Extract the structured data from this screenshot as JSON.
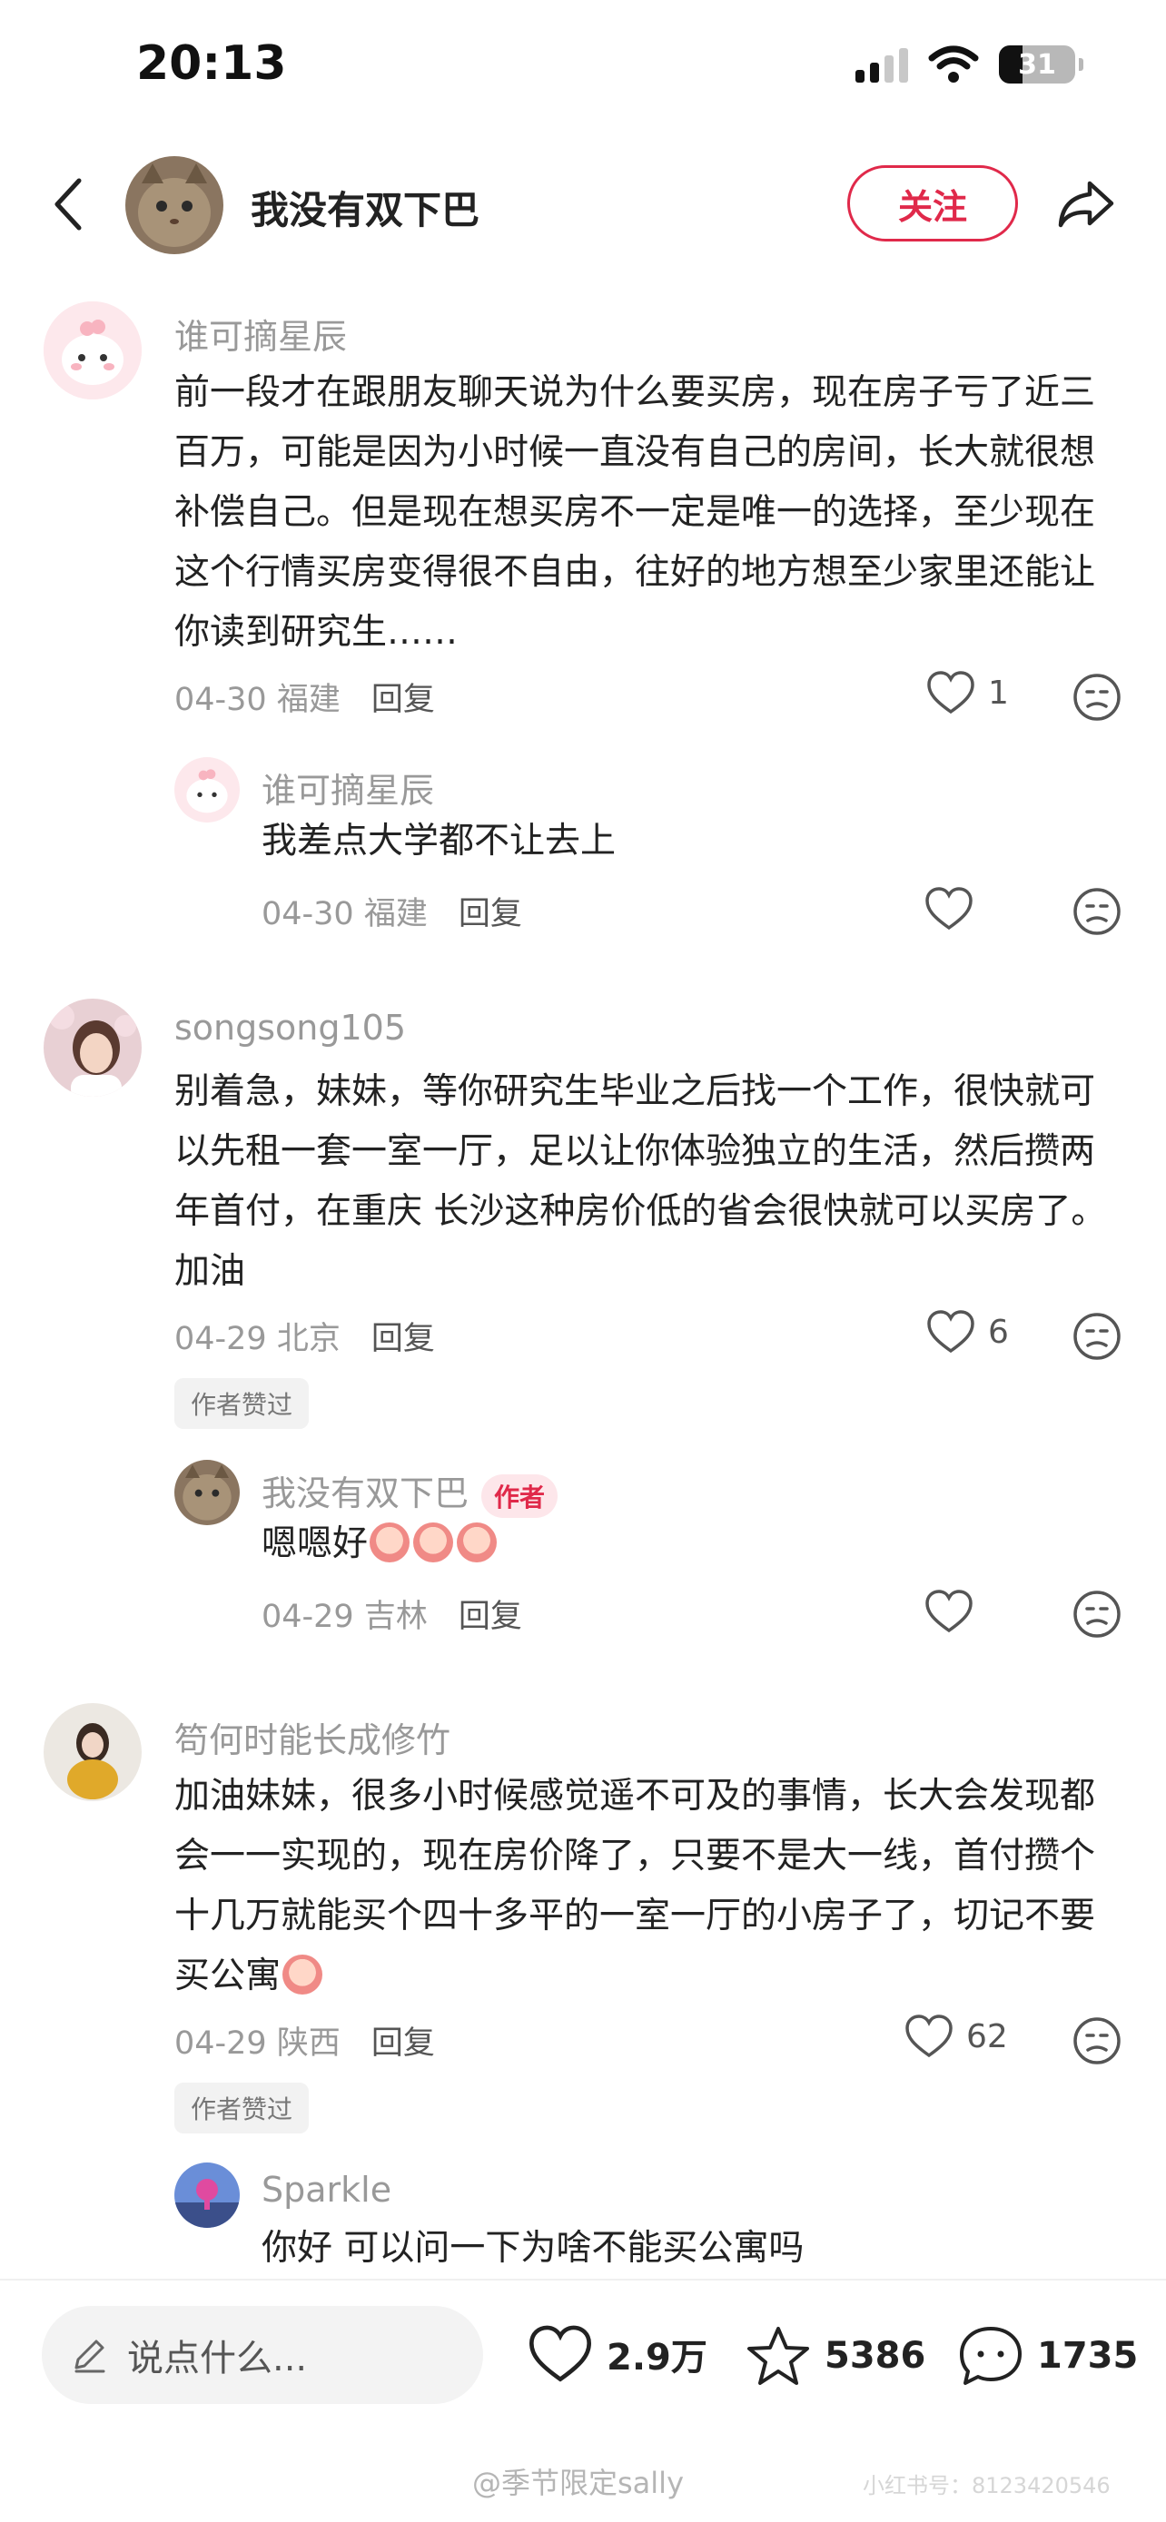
{
  "status_bar": {
    "time": "20:13",
    "battery": "31"
  },
  "header": {
    "name": "我没有双下巴",
    "follow_label": "关注"
  },
  "comments": [
    {
      "name": "谁可摘星辰",
      "text": "前一段才在跟朋友聊天说为什么要买房，现在房子亏了近三百万，可能是因为小时候一直没有自己的房间，长大就很想补偿自己。但是现在想买房不一定是唯一的选择，至少现在这个行情买房变得很不自由，往好的地方想至少家里还能让你读到研究生……",
      "date": "04-30",
      "location": "福建",
      "reply": "回复",
      "likes": "1",
      "replies": [
        {
          "name": "谁可摘星辰",
          "text": "我差点大学都不让去上",
          "date": "04-30",
          "location": "福建",
          "reply": "回复",
          "likes": ""
        }
      ]
    },
    {
      "name": "songsong105",
      "text": "别着急，妹妹，等你研究生毕业之后找一个工作，很快就可以先租一套一室一厅，足以让你体验独立的生活，然后攒两年首付，在重庆 长沙这种房价低的省会很快就可以买房了。加油",
      "date": "04-29",
      "location": "北京",
      "reply": "回复",
      "likes": "6",
      "tag": "作者赞过",
      "replies": [
        {
          "name": "我没有双下巴",
          "author_tag": "作者",
          "text": "嗯嗯好",
          "date": "04-29",
          "location": "吉林",
          "reply": "回复",
          "likes": ""
        }
      ]
    },
    {
      "name": "笱何时能长成修竹",
      "text": "加油妹妹，很多小时候感觉遥不可及的事情，长大会发现都会一一实现的，现在房价降了，只要不是大一线，首付攒个十几万就能买个四十多平的一室一厅的小房子了，切记不要买公寓",
      "date": "04-29",
      "location": "陕西",
      "reply": "回复",
      "likes": "62",
      "tag": "作者赞过",
      "replies": [
        {
          "name": "Sparkle",
          "text": "你好 可以问一下为啥不能买公寓吗"
        }
      ]
    }
  ],
  "bottom_bar": {
    "input_placeholder": "说点什么...",
    "likes": "2.9万",
    "collects": "5386",
    "comments": "1735"
  },
  "watermarks": {
    "weibo": "@季节限定sally",
    "xhs": "小红书号：8123420546"
  },
  "colors": {
    "accent": "#e0294a",
    "secondary_text": "#999999"
  },
  "icons": [
    "back-icon",
    "share-icon",
    "heart-icon",
    "dislike-face-icon",
    "pencil-icon",
    "star-icon",
    "chat-bubble-icon",
    "signal-icon",
    "wifi-icon",
    "battery-icon"
  ]
}
